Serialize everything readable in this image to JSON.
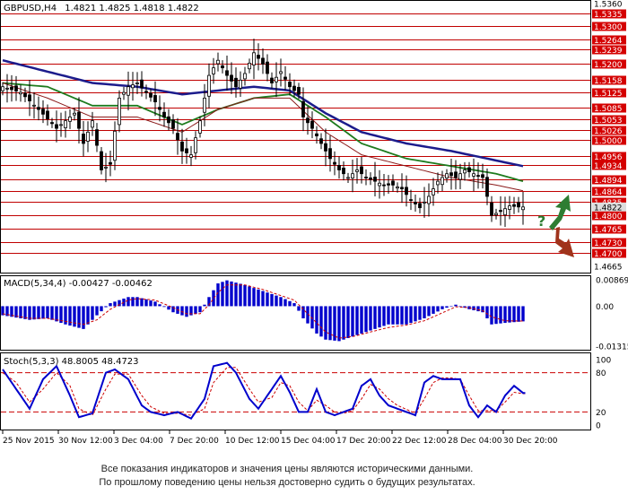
{
  "colors": {
    "background": "#ffffff",
    "frame": "#000000",
    "resistance_line": "#c00000",
    "price_label_bg": "#d40000",
    "price_label_text": "#ffffff",
    "candle": "#000000",
    "ma_fast": "#8b1a1a",
    "ma_mid": "#1e7b1e",
    "ma_slow": "#1c1c8c",
    "macd_hist": "#0000cc",
    "macd_signal": "#cc0000",
    "stoch_main": "#0000cc",
    "stoch_signal": "#cc0000",
    "stoch_level": "#cc0000",
    "arrow_up": "#2e7d32",
    "arrow_down": "#a0341c"
  },
  "chart_data": [
    {
      "type": "candlestick",
      "title": "GBPUSD,H4",
      "ohlc_header": "1.4821 1.4825 1.4818 1.4822",
      "ylim": [
        1.4665,
        1.536
      ],
      "top_tick": "1.5360",
      "bottom_tick": "1.4665",
      "current_price": "1.4822",
      "price_levels": [
        "1.5335",
        "1.5300",
        "1.5264",
        "1.5239",
        "1.5200",
        "1.5158",
        "1.5125",
        "1.5085",
        "1.5053",
        "1.5026",
        "1.5000",
        "1.4956",
        "1.4934",
        "1.4894",
        "1.4864",
        "1.4835",
        "1.4800",
        "1.4765",
        "1.4730",
        "1.4700"
      ],
      "question_mark": "?",
      "x_labels": [
        "25 Nov 2015",
        "30 Nov 12:00",
        "3 Dec 04:00",
        "7 Dec 20:00",
        "10 Dec 12:00",
        "15 Dec 04:00",
        "17 Dec 20:00",
        "22 Dec 12:00",
        "28 Dec 04:00",
        "30 Dec 20:00"
      ],
      "close_anchors": [
        [
          0,
          1.514
        ],
        [
          4,
          1.5125
        ],
        [
          8,
          1.508
        ],
        [
          12,
          1.503
        ],
        [
          16,
          1.507
        ],
        [
          18,
          1.499
        ],
        [
          20,
          1.505
        ],
        [
          22,
          1.492
        ],
        [
          24,
          1.4935
        ],
        [
          26,
          1.511
        ],
        [
          28,
          1.514
        ],
        [
          30,
          1.515
        ],
        [
          34,
          1.51
        ],
        [
          36,
          1.506
        ],
        [
          38,
          1.503
        ],
        [
          40,
          1.497
        ],
        [
          42,
          1.496
        ],
        [
          44,
          1.505
        ],
        [
          46,
          1.517
        ],
        [
          48,
          1.521
        ],
        [
          50,
          1.517
        ],
        [
          52,
          1.514
        ],
        [
          54,
          1.5175
        ],
        [
          56,
          1.523
        ],
        [
          58,
          1.52
        ],
        [
          60,
          1.515
        ],
        [
          62,
          1.518
        ],
        [
          64,
          1.514
        ],
        [
          66,
          1.512
        ],
        [
          67,
          1.506
        ],
        [
          69,
          1.503
        ],
        [
          71,
          1.499
        ],
        [
          73,
          1.495
        ],
        [
          75,
          1.492
        ],
        [
          77,
          1.49
        ],
        [
          79,
          1.492
        ],
        [
          81,
          1.49
        ],
        [
          83,
          1.489
        ],
        [
          85,
          1.488
        ],
        [
          87,
          1.488
        ],
        [
          89,
          1.487
        ],
        [
          91,
          1.484
        ],
        [
          93,
          1.482
        ],
        [
          95,
          1.485
        ],
        [
          97,
          1.489
        ],
        [
          99,
          1.491
        ],
        [
          101,
          1.49
        ],
        [
          103,
          1.492
        ],
        [
          105,
          1.491
        ],
        [
          107,
          1.49
        ],
        [
          109,
          1.48
        ],
        [
          111,
          1.481
        ],
        [
          113,
          1.4825
        ],
        [
          115,
          1.4822
        ]
      ],
      "ma_slow": [
        [
          0,
          1.521
        ],
        [
          10,
          1.518
        ],
        [
          20,
          1.515
        ],
        [
          30,
          1.514
        ],
        [
          40,
          1.512
        ],
        [
          48,
          1.513
        ],
        [
          56,
          1.514
        ],
        [
          64,
          1.513
        ],
        [
          72,
          1.507
        ],
        [
          80,
          1.502
        ],
        [
          90,
          1.499
        ],
        [
          100,
          1.497
        ],
        [
          110,
          1.4945
        ],
        [
          116,
          1.493
        ]
      ],
      "ma_mid": [
        [
          0,
          1.515
        ],
        [
          10,
          1.514
        ],
        [
          20,
          1.509
        ],
        [
          30,
          1.509
        ],
        [
          40,
          1.504
        ],
        [
          48,
          1.508
        ],
        [
          56,
          1.511
        ],
        [
          64,
          1.512
        ],
        [
          72,
          1.506
        ],
        [
          80,
          1.499
        ],
        [
          90,
          1.495
        ],
        [
          100,
          1.493
        ],
        [
          110,
          1.491
        ],
        [
          116,
          1.489
        ]
      ],
      "ma_fast": [
        [
          0,
          1.515
        ],
        [
          10,
          1.511
        ],
        [
          20,
          1.506
        ],
        [
          30,
          1.506
        ],
        [
          40,
          1.502
        ],
        [
          48,
          1.508
        ],
        [
          56,
          1.511
        ],
        [
          64,
          1.511
        ],
        [
          72,
          1.502
        ],
        [
          80,
          1.496
        ],
        [
          90,
          1.493
        ],
        [
          100,
          1.49
        ],
        [
          110,
          1.488
        ],
        [
          116,
          1.4865
        ]
      ]
    },
    {
      "type": "bar",
      "title": "MACD(5,34,4) -0.00427 -0.00462",
      "ylim": [
        -0.01315,
        0.00869
      ],
      "y_ticks": [
        "0.00869",
        "0.00",
        "-0.01315"
      ],
      "hist_anchors": [
        [
          0,
          -0.003
        ],
        [
          6,
          -0.0045
        ],
        [
          10,
          -0.004
        ],
        [
          14,
          -0.006
        ],
        [
          18,
          -0.0075
        ],
        [
          21,
          -0.003
        ],
        [
          24,
          0.001
        ],
        [
          28,
          0.003
        ],
        [
          30,
          0.003
        ],
        [
          34,
          0.0015
        ],
        [
          38,
          -0.002
        ],
        [
          41,
          -0.0035
        ],
        [
          44,
          -0.002
        ],
        [
          46,
          0.003
        ],
        [
          48,
          0.0075
        ],
        [
          50,
          0.0085
        ],
        [
          54,
          0.007
        ],
        [
          58,
          0.005
        ],
        [
          62,
          0.003
        ],
        [
          65,
          0.001
        ],
        [
          67,
          -0.004
        ],
        [
          70,
          -0.009
        ],
        [
          72,
          -0.011
        ],
        [
          75,
          -0.0115
        ],
        [
          78,
          -0.01
        ],
        [
          82,
          -0.008
        ],
        [
          86,
          -0.006
        ],
        [
          90,
          -0.006
        ],
        [
          94,
          -0.004
        ],
        [
          98,
          -0.001
        ],
        [
          101,
          0.0005
        ],
        [
          104,
          -0.001
        ],
        [
          107,
          -0.002
        ],
        [
          109,
          -0.006
        ],
        [
          112,
          -0.0055
        ],
        [
          116,
          -0.005
        ]
      ],
      "signal_anchors": [
        [
          0,
          -0.0025
        ],
        [
          6,
          -0.004
        ],
        [
          10,
          -0.004
        ],
        [
          14,
          -0.005
        ],
        [
          18,
          -0.006
        ],
        [
          21,
          -0.0045
        ],
        [
          24,
          -0.001
        ],
        [
          28,
          0.002
        ],
        [
          30,
          0.0025
        ],
        [
          34,
          0.002
        ],
        [
          38,
          -0.0005
        ],
        [
          41,
          -0.0025
        ],
        [
          44,
          -0.0025
        ],
        [
          46,
          0.0005
        ],
        [
          48,
          0.0045
        ],
        [
          50,
          0.007
        ],
        [
          54,
          0.007
        ],
        [
          58,
          0.0055
        ],
        [
          62,
          0.0035
        ],
        [
          65,
          0.002
        ],
        [
          67,
          -0.001
        ],
        [
          70,
          -0.0055
        ],
        [
          72,
          -0.0085
        ],
        [
          75,
          -0.0105
        ],
        [
          78,
          -0.01
        ],
        [
          82,
          -0.0085
        ],
        [
          86,
          -0.007
        ],
        [
          90,
          -0.0062
        ],
        [
          94,
          -0.0048
        ],
        [
          98,
          -0.0022
        ],
        [
          101,
          -0.0002
        ],
        [
          104,
          -0.0005
        ],
        [
          107,
          -0.0015
        ],
        [
          109,
          -0.0035
        ],
        [
          112,
          -0.0048
        ],
        [
          116,
          -0.0049
        ]
      ]
    },
    {
      "type": "line",
      "title": "Stoch(5,3,3) 48.8005 48.4723",
      "ylim": [
        0,
        100
      ],
      "y_ticks": [
        "100",
        "80",
        "20",
        "0"
      ],
      "levels": [
        80,
        20
      ],
      "main_anchors": [
        [
          0,
          85
        ],
        [
          3,
          55
        ],
        [
          6,
          25
        ],
        [
          9,
          70
        ],
        [
          12,
          90
        ],
        [
          15,
          45
        ],
        [
          17,
          12
        ],
        [
          20,
          18
        ],
        [
          23,
          80
        ],
        [
          25,
          85
        ],
        [
          28,
          70
        ],
        [
          31,
          30
        ],
        [
          33,
          20
        ],
        [
          36,
          15
        ],
        [
          39,
          20
        ],
        [
          42,
          10
        ],
        [
          45,
          40
        ],
        [
          47,
          90
        ],
        [
          50,
          95
        ],
        [
          52,
          80
        ],
        [
          55,
          40
        ],
        [
          57,
          25
        ],
        [
          60,
          55
        ],
        [
          62,
          75
        ],
        [
          64,
          50
        ],
        [
          66,
          20
        ],
        [
          68,
          20
        ],
        [
          70,
          55
        ],
        [
          72,
          20
        ],
        [
          74,
          15
        ],
        [
          76,
          20
        ],
        [
          78,
          25
        ],
        [
          80,
          60
        ],
        [
          82,
          70
        ],
        [
          84,
          45
        ],
        [
          86,
          30
        ],
        [
          88,
          25
        ],
        [
          90,
          20
        ],
        [
          92,
          15
        ],
        [
          94,
          65
        ],
        [
          96,
          75
        ],
        [
          98,
          70
        ],
        [
          100,
          70
        ],
        [
          102,
          70
        ],
        [
          104,
          30
        ],
        [
          106,
          12
        ],
        [
          108,
          30
        ],
        [
          110,
          20
        ],
        [
          112,
          45
        ],
        [
          114,
          60
        ],
        [
          116,
          49
        ]
      ],
      "signal_anchors": [
        [
          0,
          80
        ],
        [
          3,
          65
        ],
        [
          6,
          35
        ],
        [
          9,
          55
        ],
        [
          12,
          80
        ],
        [
          15,
          60
        ],
        [
          17,
          25
        ],
        [
          20,
          15
        ],
        [
          23,
          55
        ],
        [
          25,
          78
        ],
        [
          28,
          78
        ],
        [
          31,
          45
        ],
        [
          33,
          28
        ],
        [
          36,
          18
        ],
        [
          39,
          18
        ],
        [
          42,
          15
        ],
        [
          45,
          25
        ],
        [
          47,
          65
        ],
        [
          50,
          88
        ],
        [
          52,
          88
        ],
        [
          55,
          55
        ],
        [
          57,
          35
        ],
        [
          60,
          42
        ],
        [
          62,
          65
        ],
        [
          64,
          60
        ],
        [
          66,
          35
        ],
        [
          68,
          22
        ],
        [
          70,
          38
        ],
        [
          72,
          30
        ],
        [
          74,
          20
        ],
        [
          76,
          18
        ],
        [
          78,
          22
        ],
        [
          80,
          40
        ],
        [
          82,
          62
        ],
        [
          84,
          55
        ],
        [
          86,
          40
        ],
        [
          88,
          30
        ],
        [
          90,
          24
        ],
        [
          92,
          18
        ],
        [
          94,
          40
        ],
        [
          96,
          65
        ],
        [
          98,
          72
        ],
        [
          100,
          72
        ],
        [
          102,
          70
        ],
        [
          104,
          45
        ],
        [
          106,
          22
        ],
        [
          108,
          22
        ],
        [
          110,
          22
        ],
        [
          112,
          35
        ],
        [
          114,
          50
        ],
        [
          116,
          48
        ]
      ]
    }
  ],
  "disclaimer": {
    "line1": "Все показания индикаторов и значения цены являются историческими данными.",
    "line2": "По прошлому поведению цены нельзя достоверно судить о будущих результатах."
  }
}
